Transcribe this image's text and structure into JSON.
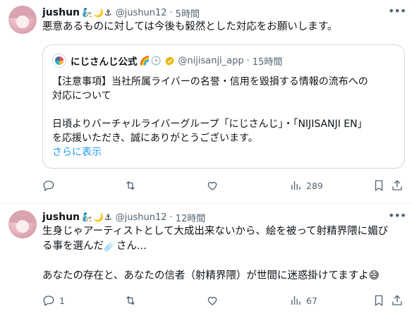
{
  "posts": [
    {
      "author": "jushun",
      "emojis": "🧞🌙⚓",
      "handle": "@jushun12",
      "separator": "·",
      "time": "5時間",
      "text": "悪意あるものに対しては今後も毅然とした対応をお願いします。",
      "quote": {
        "author": "にじさんじ公式",
        "emojis": "🌈🕒",
        "handle": "@nijisanji_app",
        "separator": "·",
        "time": "15時間",
        "text_lines": [
          "【注意事項】当社所属ライバーの名誉・信用を毀損する情報の流布への",
          "対応について",
          "",
          "日頃よりバーチャルライバーグループ「にじさんじ」・「NIJISANJI EN」",
          "を応援いただき、誠にありがとうございます。"
        ],
        "show_more": "さらに表示"
      },
      "actions": {
        "replies": "",
        "retweets": "",
        "likes": "",
        "views": "289"
      }
    },
    {
      "author": "jushun",
      "emojis": "🧞🌙⚓",
      "handle": "@jushun12",
      "separator": "·",
      "time": "12時間",
      "text_lines": [
        "生身じゃアーティストとして大成出来ないから、絵を被って射精界隈に媚び",
        "る事を選んだ☄️さん...",
        "",
        "あなたの存在と、あなたの信者（射精界隈）が世間に迷惑掛けてますよ😅"
      ],
      "actions": {
        "replies": "1",
        "retweets": "",
        "likes": "",
        "views": "67"
      }
    }
  ],
  "colors": {
    "text": "#0f1419",
    "muted": "#536471",
    "link": "#1d9bf0",
    "border": "#cfd9de",
    "verified": "#e8b400"
  },
  "icons": {
    "more": "more-options-icon",
    "reply": "reply-icon",
    "retweet": "retweet-icon",
    "like": "like-icon",
    "views": "views-icon",
    "share": "share-icon",
    "verified": "verified-badge-icon"
  }
}
